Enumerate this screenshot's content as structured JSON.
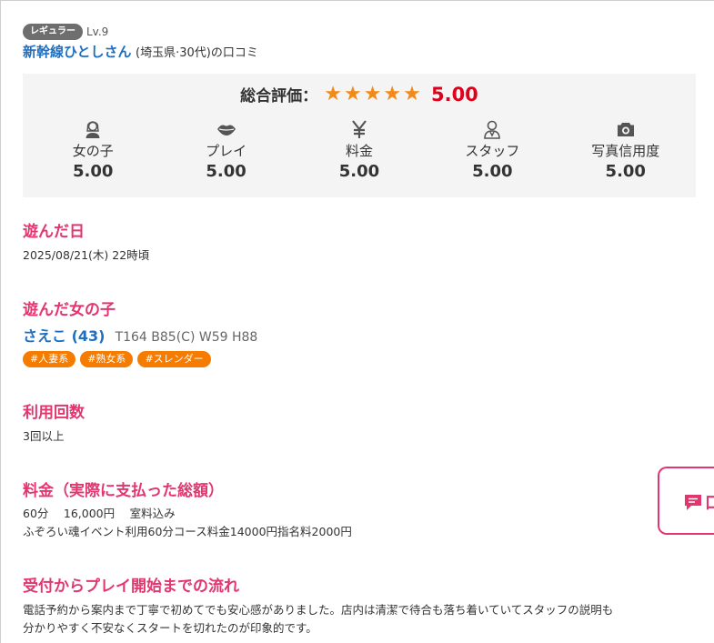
{
  "reviewer": {
    "rank_badge": "レギュラー",
    "level": "Lv.9",
    "name": "新幹線ひとしさん",
    "meta": "(埼玉県·30代)の口コミ"
  },
  "rating": {
    "overall_label": "総合評価：",
    "stars": "★★★★★",
    "star_value": 5,
    "overall_score": "5.00",
    "categories": [
      {
        "icon": "girl-icon",
        "label": "女の子",
        "score": "5.00"
      },
      {
        "icon": "lips-icon",
        "label": "プレイ",
        "score": "5.00"
      },
      {
        "icon": "yen-icon",
        "label": "料金",
        "score": "5.00"
      },
      {
        "icon": "staff-icon",
        "label": "スタッフ",
        "score": "5.00"
      },
      {
        "icon": "camera-icon",
        "label": "写真信用度",
        "score": "5.00"
      }
    ]
  },
  "visit_date": {
    "title": "遊んだ日",
    "value": "2025/08/21(木) 22時頃"
  },
  "girl": {
    "title": "遊んだ女の子",
    "name": "さえこ (43)",
    "stats": "T164 B85(C) W59 H88",
    "tags": [
      "#人妻系",
      "#熟女系",
      "#スレンダー"
    ]
  },
  "usage": {
    "title": "利用回数",
    "value": "3回以上"
  },
  "price": {
    "title": "料金（実際に支払った総額）",
    "line1": "60分　 16,000円　 室料込み",
    "line2": "ふぞろい魂イベント利用60分コース料金14000円指名料2000円"
  },
  "flow": {
    "title": "受付からプレイ開始までの流れ",
    "line1": "電話予約から案内まで丁寧で初めてでも安心感がありました。店内は清潔で待合も落ち着いていてスタッフの説明も",
    "line2": "分かりやすく不安なくスタートを切れたのが印象的です。"
  },
  "floating_button": {
    "label": "口"
  },
  "colors": {
    "accent": "#e2366f",
    "link": "#1e6fc1",
    "star": "#f28a1a",
    "score": "#e0001b",
    "tag": "#f57c00"
  }
}
